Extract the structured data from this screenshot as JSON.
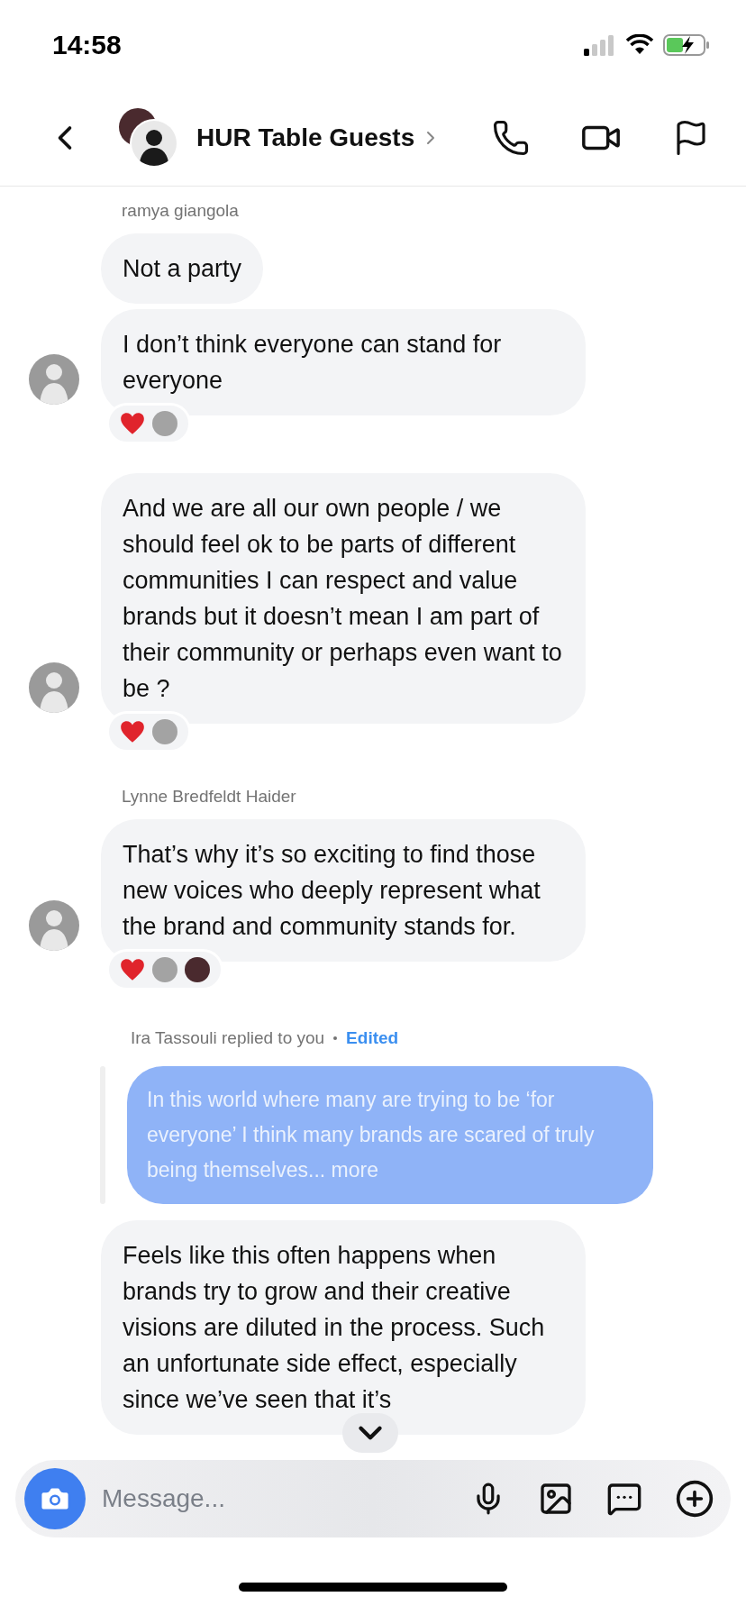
{
  "status_bar": {
    "time": "14:58"
  },
  "header": {
    "title": "HUR Table Guests"
  },
  "messages": [
    {
      "kind": "sender",
      "text": "ramya giangola"
    },
    {
      "kind": "bubble",
      "text": "Not a party",
      "avatar": false
    },
    {
      "kind": "bubble",
      "text": "I don’t think everyone can stand for everyone",
      "avatar": true,
      "reactions": [
        {
          "kind": "heart"
        },
        {
          "kind": "avatar",
          "color": "#a3a3a3"
        }
      ]
    },
    {
      "kind": "bubble",
      "text": "And we are all our own people / we should feel ok to be parts of different communities I can respect and value brands but it doesn’t mean I am part of their community or perhaps even want to be ?",
      "avatar": true,
      "reactions": [
        {
          "kind": "heart"
        },
        {
          "kind": "avatar",
          "color": "#a3a3a3"
        }
      ]
    },
    {
      "kind": "sender",
      "text": "Lynne Bredfeldt Haider"
    },
    {
      "kind": "bubble",
      "text": "That’s why it’s so exciting to find those new voices who deeply represent what the brand and community stands for.",
      "avatar": true,
      "reactions": [
        {
          "kind": "heart"
        },
        {
          "kind": "avatar",
          "color": "#a3a3a3"
        },
        {
          "kind": "avatar",
          "color": "#4a2a2e"
        }
      ]
    },
    {
      "kind": "reply_header",
      "text": "Ira Tassouli replied to you",
      "tag": "Edited"
    },
    {
      "kind": "quote",
      "text": "In this world where many are trying to be ‘for everyone’ I think many brands are scared of truly being themselves... more"
    },
    {
      "kind": "bubble",
      "text": "Feels like this often happens when brands try to grow and their creative visions are diluted in the process. Such an unfortunate side effect, especially since we’ve seen that it’s",
      "avatar": false
    }
  ],
  "composer": {
    "placeholder": "Message..."
  }
}
